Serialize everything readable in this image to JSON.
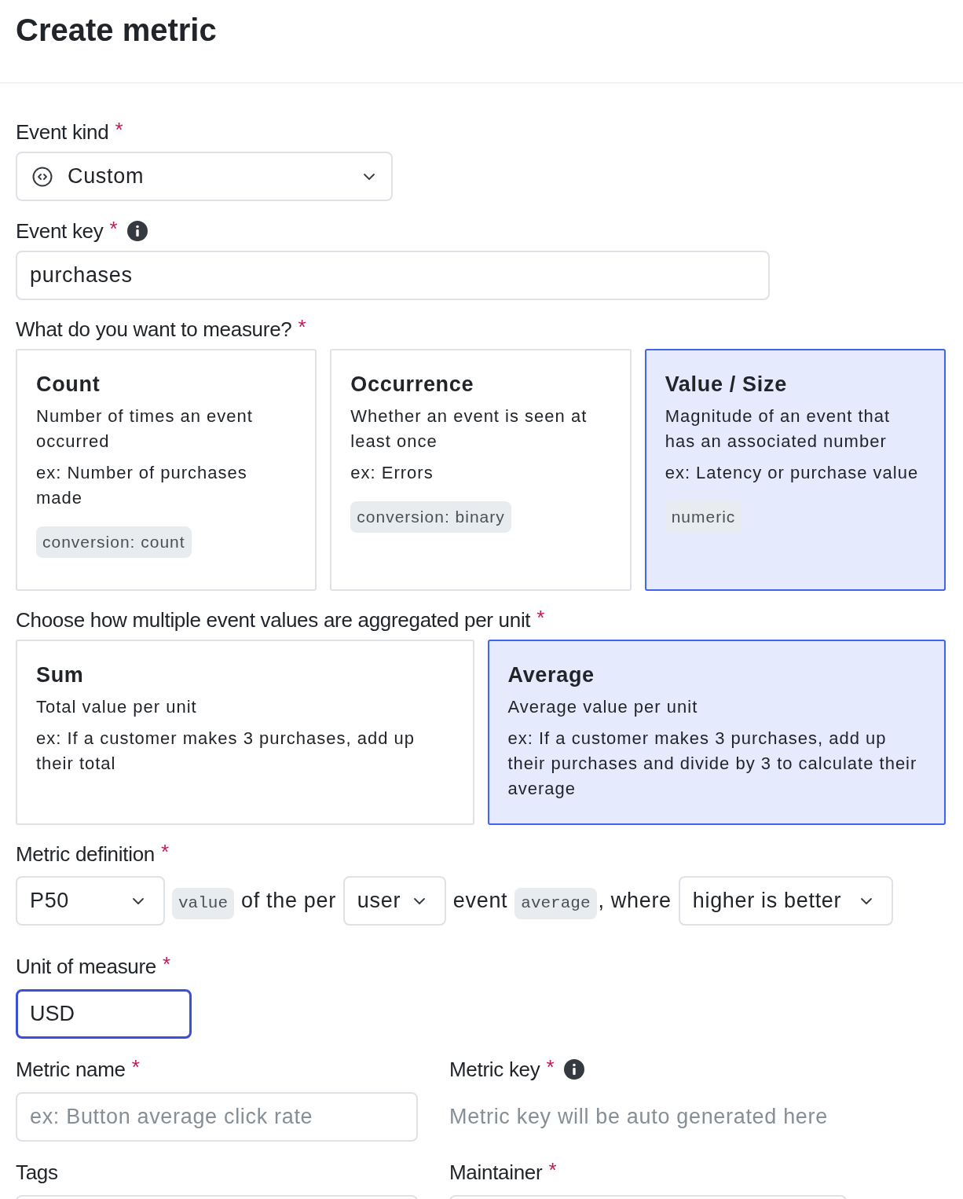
{
  "title": "Create metric",
  "event_kind": {
    "label": "Event kind",
    "required_mark": "*",
    "value": "Custom"
  },
  "event_key": {
    "label": "Event key",
    "required_mark": "*",
    "info": true,
    "value": "purchases"
  },
  "measure": {
    "label": "What do you want to measure?",
    "required_mark": "*",
    "options": [
      {
        "title": "Count",
        "description": "Number of times an event occurred",
        "example": "ex: Number of purchases made",
        "tag": "conversion: count",
        "selected": false
      },
      {
        "title": "Occurrence",
        "description": "Whether an event is seen at least once",
        "example": "ex: Errors",
        "tag": "conversion: binary",
        "selected": false
      },
      {
        "title": "Value / Size",
        "description": "Magnitude of an event that has an associated number",
        "example": "ex: Latency or purchase value",
        "tag": "numeric",
        "selected": true
      }
    ]
  },
  "aggregation": {
    "label": "Choose how multiple event values are aggregated per unit",
    "required_mark": "*",
    "options": [
      {
        "title": "Sum",
        "description": "Total value per unit",
        "example": "ex: If a customer makes 3 purchases, add up their total",
        "selected": false
      },
      {
        "title": "Average",
        "description": "Average value per unit",
        "example": "ex: If a customer makes 3 purchases, add up their purchases and divide by 3 to calculate their average",
        "selected": true
      }
    ]
  },
  "metric_definition": {
    "label": "Metric definition",
    "required_mark": "*",
    "parts": [
      {
        "kind": "select",
        "value": "P50"
      },
      {
        "kind": "code",
        "text": "value"
      },
      {
        "kind": "text",
        "text": "of the per"
      },
      {
        "kind": "select",
        "value": "user"
      },
      {
        "kind": "text",
        "text": "event"
      },
      {
        "kind": "code",
        "text": "average"
      },
      {
        "kind": "text",
        "text": ", where",
        "joined": true
      },
      {
        "kind": "select",
        "value": "higher is better"
      }
    ]
  },
  "unit": {
    "label": "Unit of measure",
    "required_mark": "*",
    "value": "USD",
    "focused": true
  },
  "metric_name": {
    "label": "Metric name",
    "required_mark": "*",
    "placeholder": "ex: Button average click rate"
  },
  "metric_key": {
    "label": "Metric key",
    "required_mark": "*",
    "info": true,
    "hint": "Metric key will be auto generated here"
  },
  "tags": {
    "label": "Tags"
  },
  "maintainer": {
    "label": "Maintainer",
    "required_mark": "*"
  }
}
